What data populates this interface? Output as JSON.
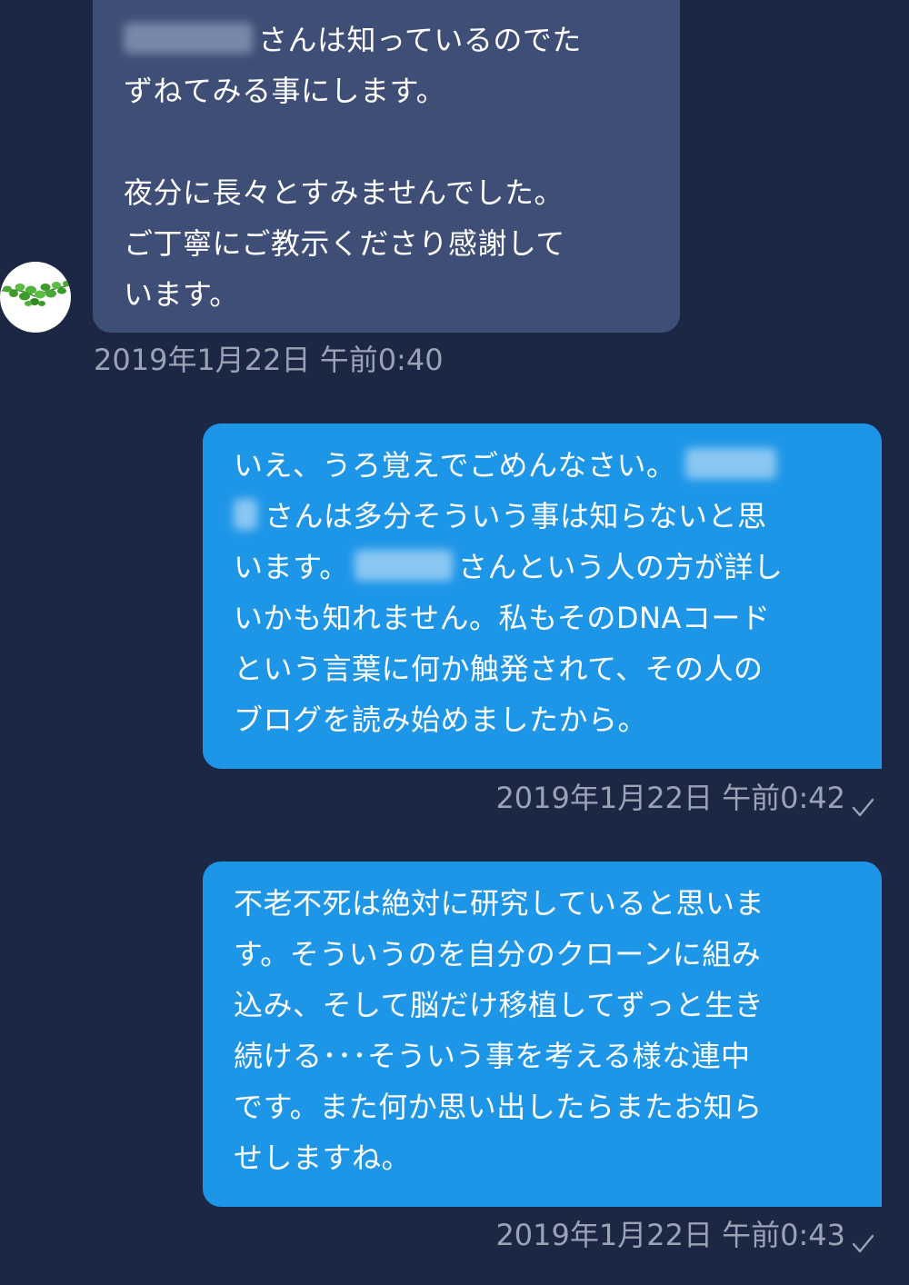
{
  "colors": {
    "background": "#1c2744",
    "incoming_bubble": "#3f4e77",
    "outgoing_bubble": "#1e96e8",
    "timestamp": "#9aa3b5"
  },
  "avatar": {
    "icon": "ivy-leaves-icon"
  },
  "messages": [
    {
      "direction": "incoming",
      "lines": [
        "さんは知っているのでた",
        "ずねてみる事にします。",
        "",
        "夜分に長々とすみませんでした。",
        "ご丁寧にご教示くださり感謝して",
        "います。"
      ],
      "timestamp": "2019年1月22日 午前0:40"
    },
    {
      "direction": "outgoing",
      "lines": [
        "いえ、うろ覚えでごめんなさい。",
        "さんは多分そういう事は知らないと思",
        "います。",
        "さんという人の方が詳し",
        "いかも知れません。私もそのDNAコード",
        "という言葉に何か触発されて、その人の",
        "ブログを読み始めましたから。"
      ],
      "timestamp": "2019年1月22日 午前0:42",
      "read_icon": "checkmark-icon"
    },
    {
      "direction": "outgoing",
      "lines": [
        "不老不死は絶対に研究していると思いま",
        "す。そういうのを自分のクローンに組み",
        "込み、そして脳だけ移植してずっと生き",
        "続ける･･･そういう事を考える様な連中",
        "です。また何か思い出したらまたお知ら",
        "せしますね。"
      ],
      "timestamp": "2019年1月22日 午前0:43",
      "read_icon": "checkmark-icon"
    }
  ]
}
